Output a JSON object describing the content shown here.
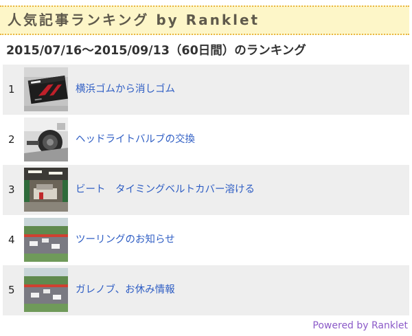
{
  "widget": {
    "title": "人気記事ランキング by Ranklet",
    "period_label": "2015/07/16〜2015/09/13（60日間）のランキング",
    "powered_by": "Powered by Ranklet"
  },
  "ranking": [
    {
      "rank": "1",
      "title": "横浜ゴムから消しゴム",
      "thumbnail": "eraser-product-photo"
    },
    {
      "rank": "2",
      "title": "ヘッドライトバルブの交換",
      "thumbnail": "headlight-bulb-photo"
    },
    {
      "rank": "3",
      "title": "ビート　タイミングベルトカバー溶ける",
      "thumbnail": "garage-workshop-photo"
    },
    {
      "rank": "4",
      "title": "ツーリングのお知らせ",
      "thumbnail": "racing-circuit-photo"
    },
    {
      "rank": "5",
      "title": "ガレノブ、お休み情報",
      "thumbnail": "racing-circuit-photo"
    }
  ],
  "colors": {
    "header_bg": "#fdf6c8",
    "header_border": "#e9b640",
    "link": "#2f5ec4",
    "powered": "#8b5ac8",
    "row_alt": "#eeeeee"
  }
}
